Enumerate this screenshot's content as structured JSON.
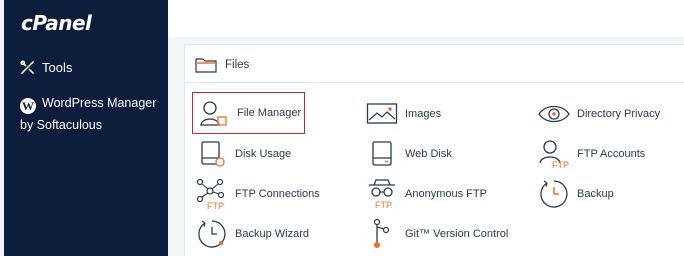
{
  "brand": {
    "logo": "cPanel"
  },
  "sidebar": {
    "items": [
      {
        "label": "Tools",
        "icon": "tools-icon"
      },
      {
        "label": "WordPress Manager by Softaculous",
        "icon": "wordpress-icon"
      }
    ]
  },
  "section": {
    "title": "Files",
    "icon": "folder-icon"
  },
  "files": [
    {
      "label": "File Manager",
      "icon": "file-manager-icon",
      "selected": true
    },
    {
      "label": "Images",
      "icon": "images-icon"
    },
    {
      "label": "Directory Privacy",
      "icon": "eye-icon"
    },
    {
      "label": "Disk Usage",
      "icon": "disk-usage-icon"
    },
    {
      "label": "Web Disk",
      "icon": "web-disk-icon"
    },
    {
      "label": "FTP Accounts",
      "icon": "ftp-accounts-icon"
    },
    {
      "label": "FTP Connections",
      "icon": "ftp-connections-icon"
    },
    {
      "label": "Anonymous FTP",
      "icon": "anonymous-ftp-icon"
    },
    {
      "label": "Backup",
      "icon": "backup-icon"
    },
    {
      "label": "Backup Wizard",
      "icon": "backup-wizard-icon"
    },
    {
      "label": "Git™ Version Control",
      "icon": "git-icon"
    }
  ],
  "icon_badges": {
    "ftp": "FTP"
  },
  "colors": {
    "sidebar": "#0d1e3c",
    "accent": "#e8742c",
    "selected_border": "#c9272c",
    "icon": "#293a4a"
  }
}
